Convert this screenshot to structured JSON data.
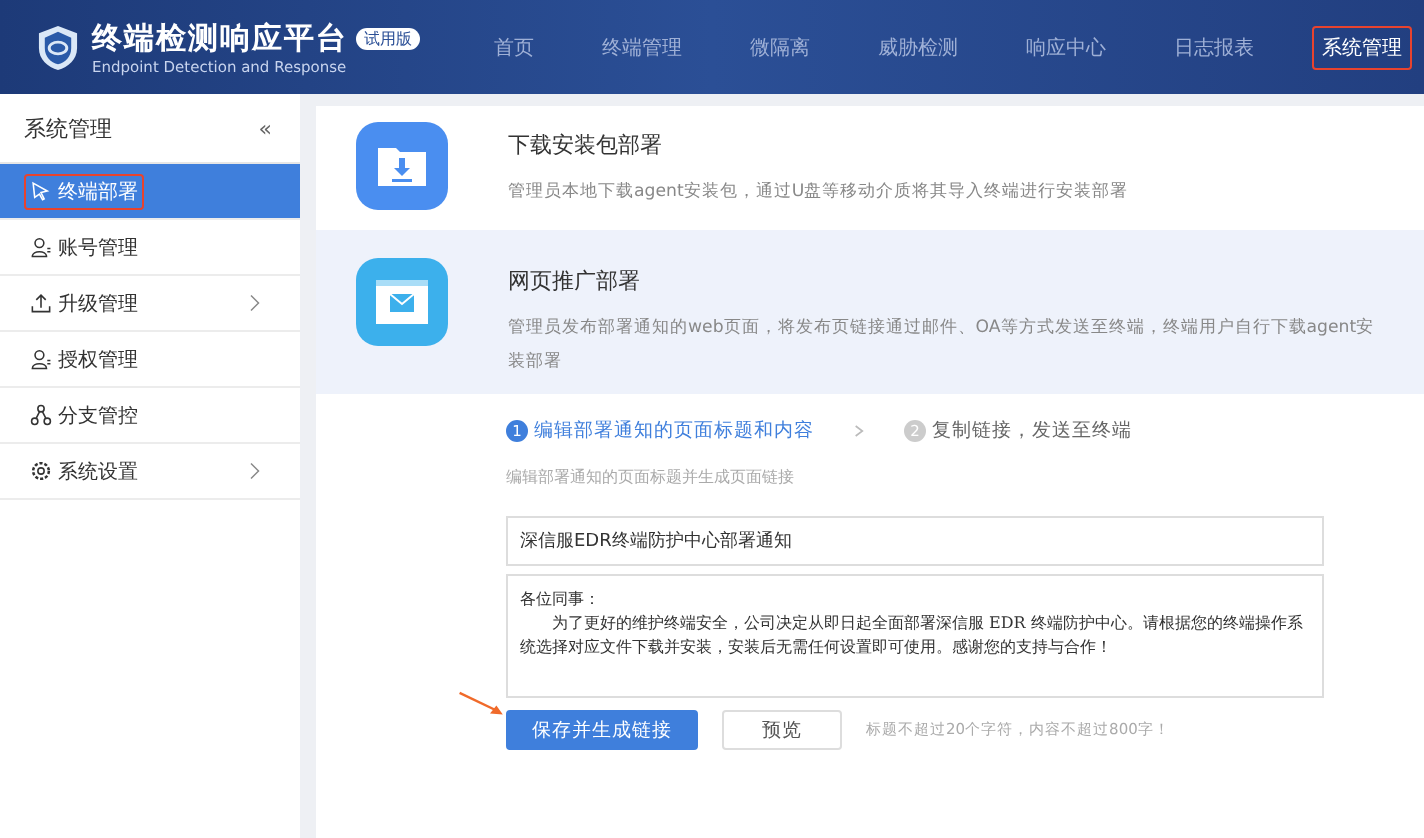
{
  "header": {
    "title": "终端检测响应平台",
    "subtitle": "Endpoint Detection and Response",
    "badge": "试用版",
    "nav": [
      {
        "label": "首页",
        "selected": false,
        "highlighted": false
      },
      {
        "label": "终端管理",
        "selected": false,
        "highlighted": false
      },
      {
        "label": "微隔离",
        "selected": false,
        "highlighted": false
      },
      {
        "label": "威胁检测",
        "selected": false,
        "highlighted": false
      },
      {
        "label": "响应中心",
        "selected": false,
        "highlighted": false
      },
      {
        "label": "日志报表",
        "selected": false,
        "highlighted": false
      },
      {
        "label": "系统管理",
        "selected": true,
        "highlighted": true
      }
    ]
  },
  "sidebar": {
    "title": "系统管理",
    "collapse": "«",
    "items": [
      {
        "label": "终端部署",
        "kind": "pointer",
        "selected": true,
        "highlighted": true,
        "expandable": false
      },
      {
        "label": "账号管理",
        "kind": "user",
        "selected": false,
        "highlighted": false,
        "expandable": false
      },
      {
        "label": "升级管理",
        "kind": "upload",
        "selected": false,
        "highlighted": false,
        "expandable": true
      },
      {
        "label": "授权管理",
        "kind": "user",
        "selected": false,
        "highlighted": false,
        "expandable": false
      },
      {
        "label": "分支管控",
        "kind": "branch",
        "selected": false,
        "highlighted": false,
        "expandable": false
      },
      {
        "label": "系统设置",
        "kind": "gear",
        "selected": false,
        "highlighted": false,
        "expandable": true
      }
    ]
  },
  "methods": [
    {
      "kind": "download",
      "title": "下载安装包部署",
      "description": "管理员本地下载agent安装包，通过U盘等移动介质将其导入终端进行安装部署",
      "selected": false
    },
    {
      "kind": "web",
      "title": "网页推广部署",
      "description": "管理员发布部署通知的web页面，将发布页链接通过邮件、OA等方式发送至终端，终端用户自行下载agent安装部署",
      "selected": true
    }
  ],
  "steps": [
    {
      "number": "1",
      "label": "编辑部署通知的页面标题和内容",
      "selected": true
    },
    {
      "number": "2",
      "label": "复制链接，发送至终端",
      "selected": false
    }
  ],
  "step_hint": "编辑部署通知的页面标题并生成页面链接",
  "form": {
    "title_value": "深信服EDR终端防护中心部署通知",
    "content_lines": [
      "各位同事：",
      "为了更好的维护终端安全，公司决定从即日起全面部署深信服 EDR 终端防护中心。请根据您的终端操作系统选择对应文件下载并安装，安装后无需任何设置即可使用。感谢您的支持与合作！"
    ]
  },
  "buttons": [
    {
      "label": "保存并生成链接",
      "kind": "primary"
    },
    {
      "label": "预览",
      "kind": "default"
    }
  ],
  "limit_note": "标题不超过20个字符，内容不超过800字！",
  "annotation_arrow": true
}
